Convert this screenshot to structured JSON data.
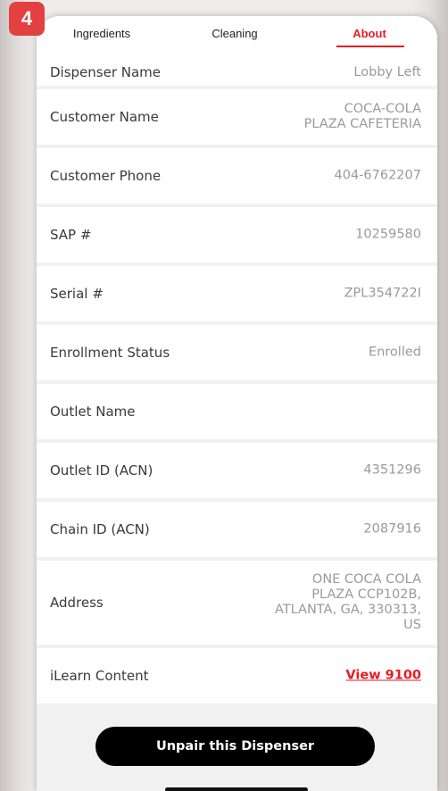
{
  "badge": "4",
  "tabs": [
    {
      "label": "Ingredients"
    },
    {
      "label": "Cleaning"
    },
    {
      "label": "About"
    }
  ],
  "rows": [
    {
      "label": "Dispenser Name",
      "value": "Lobby Left"
    },
    {
      "label": "Customer Name",
      "value": "COCA-COLA\nPLAZA CAFETERIA"
    },
    {
      "label": "Customer Phone",
      "value": "404-6762207"
    },
    {
      "label": "SAP #",
      "value": "10259580"
    },
    {
      "label": "Serial #",
      "value": "ZPL354722I"
    },
    {
      "label": "Enrollment Status",
      "value": "Enrolled"
    },
    {
      "label": "Outlet Name",
      "value": ""
    },
    {
      "label": "Outlet ID (ACN)",
      "value": "4351296"
    },
    {
      "label": "Chain ID (ACN)",
      "value": "2087916"
    },
    {
      "label": "Address",
      "value": "ONE COCA COLA\nPLAZA CCP102B,\nATLANTA, GA, 330313,\nUS"
    },
    {
      "label": "iLearn Content",
      "value": "View 9100"
    }
  ],
  "unpair_label": "Unpair this Dispenser",
  "colors": {
    "accent": "#e61c24",
    "badge": "#e34040"
  }
}
